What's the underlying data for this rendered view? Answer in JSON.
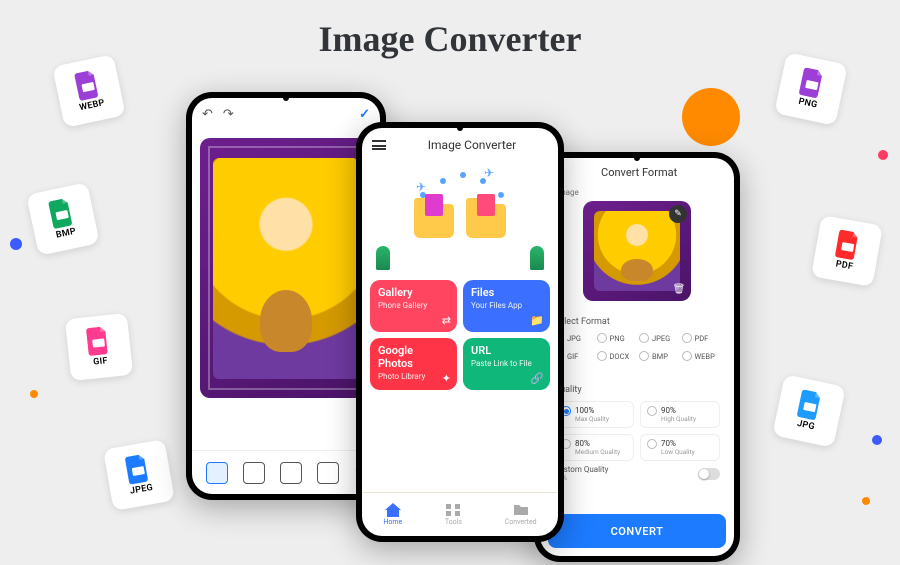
{
  "title": "Image Converter",
  "format_cards": {
    "webp": "WEBP",
    "bmp": "BMP",
    "gif": "GIF",
    "jpeg": "JPEG",
    "png": "PNG",
    "pdf": "PDF",
    "jpg": "JPG"
  },
  "format_colors": {
    "webp": "#9b3fd6",
    "bmp": "#0fa85f",
    "gif": "#ff3b8f",
    "jpeg": "#1d7bff",
    "png": "#9b3fd6",
    "pdf": "#ff2a2a",
    "jpg": "#1d9bff"
  },
  "phone_a": {
    "check": "✓"
  },
  "phone_b": {
    "title": "Image Converter",
    "tiles": [
      {
        "title": "Gallery",
        "sub": "Phone Gallery",
        "icon": "⇄"
      },
      {
        "title": "Files",
        "sub": "Your Files App",
        "icon": "📁"
      },
      {
        "title": "Google Photos",
        "sub": "Photo Library",
        "icon": "✦"
      },
      {
        "title": "URL",
        "sub": "Paste Link to File",
        "icon": "🔗"
      }
    ],
    "nav": [
      {
        "label": "Home"
      },
      {
        "label": "Tools"
      },
      {
        "label": "Converted"
      }
    ]
  },
  "phone_c": {
    "title": "Convert Format",
    "count": "1 Image",
    "select_format_label": "Select Format",
    "formats": [
      "JPG",
      "PNG",
      "JPEG",
      "PDF",
      "GIF",
      "DOCX",
      "BMP",
      "WEBP"
    ],
    "selected_format": "JPG",
    "quality_label": "Quality",
    "quality_options": [
      {
        "pct": "100%",
        "sub": "Max Quality"
      },
      {
        "pct": "90%",
        "sub": "High Quality"
      },
      {
        "pct": "80%",
        "sub": "Medium Quality"
      },
      {
        "pct": "70%",
        "sub": "Low Quality"
      }
    ],
    "selected_quality": "100%",
    "custom_quality_label": "Custom Quality",
    "custom_quality_value": "50%",
    "convert_button": "CONVERT"
  }
}
